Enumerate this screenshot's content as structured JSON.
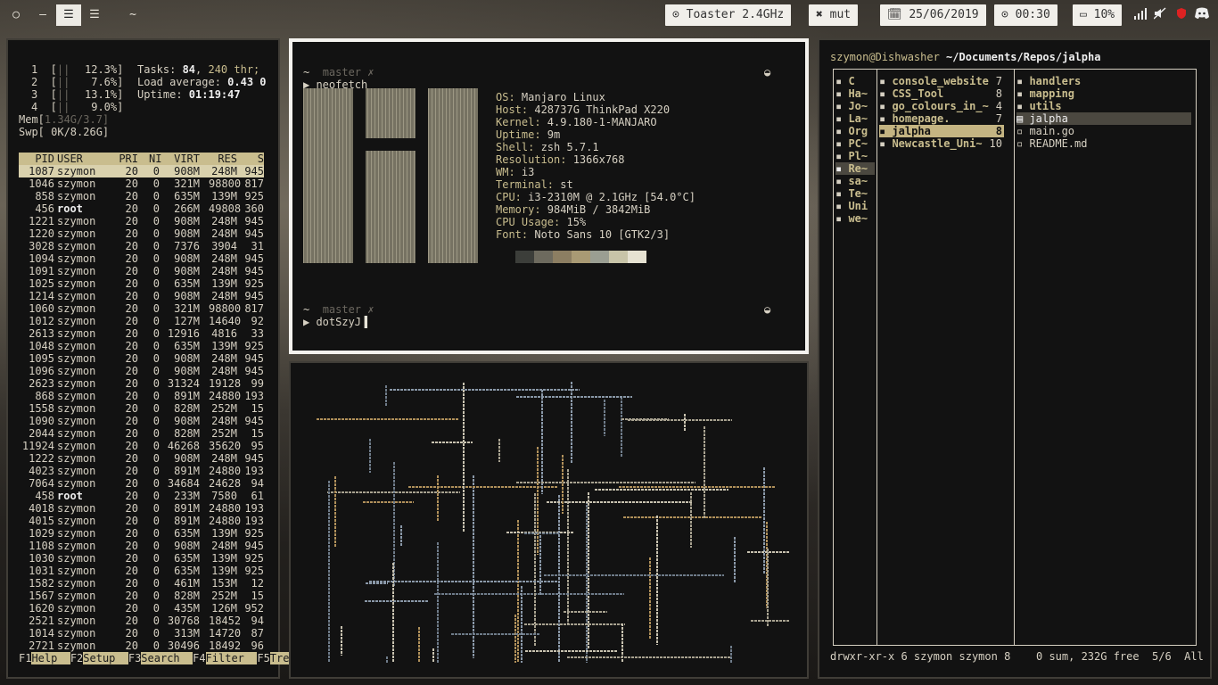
{
  "topbar": {
    "workspaces": [
      "○",
      "—",
      "☰",
      "☰",
      "~"
    ],
    "active_workspace": 2,
    "status": {
      "cpu": "⊙ Toaster 2.4GHz",
      "volume": "✖ mut",
      "date": "🗓 25/06/2019",
      "time": "⊙ 00:30",
      "battery": "▭ 10%"
    }
  },
  "htop": {
    "cpus": [
      {
        "id": "1",
        "pct": "12.3%]"
      },
      {
        "id": "2",
        "pct": "7.6%]"
      },
      {
        "id": "3",
        "pct": "13.1%]"
      },
      {
        "id": "4",
        "pct": "9.0%]"
      }
    ],
    "mem": "1.34G/3.7]",
    "swp": "0K/8.26G]",
    "tasks_label": "Tasks: ",
    "tasks": "84",
    "threads": "240 thr;",
    "load_label": "Load average: ",
    "load": "0.43 0",
    "uptime_label": "Uptime: ",
    "uptime": "01:19:47",
    "columns": [
      "PID",
      "USER",
      "PRI",
      "NI",
      "VIRT",
      "RES",
      "S"
    ],
    "rows": [
      [
        "1087",
        "szymon",
        "20",
        "0",
        "908M",
        "248M",
        "945"
      ],
      [
        "1046",
        "szymon",
        "20",
        "0",
        "321M",
        "98800",
        "817"
      ],
      [
        "858",
        "szymon",
        "20",
        "0",
        "635M",
        "139M",
        "925"
      ],
      [
        "456",
        "root",
        "20",
        "0",
        "266M",
        "49808",
        "360"
      ],
      [
        "1221",
        "szymon",
        "20",
        "0",
        "908M",
        "248M",
        "945"
      ],
      [
        "1220",
        "szymon",
        "20",
        "0",
        "908M",
        "248M",
        "945"
      ],
      [
        "3028",
        "szymon",
        "20",
        "0",
        "7376",
        "3904",
        "31"
      ],
      [
        "1094",
        "szymon",
        "20",
        "0",
        "908M",
        "248M",
        "945"
      ],
      [
        "1091",
        "szymon",
        "20",
        "0",
        "908M",
        "248M",
        "945"
      ],
      [
        "1025",
        "szymon",
        "20",
        "0",
        "635M",
        "139M",
        "925"
      ],
      [
        "1214",
        "szymon",
        "20",
        "0",
        "908M",
        "248M",
        "945"
      ],
      [
        "1060",
        "szymon",
        "20",
        "0",
        "321M",
        "98800",
        "817"
      ],
      [
        "1012",
        "szymon",
        "20",
        "0",
        "127M",
        "14640",
        "92"
      ],
      [
        "2613",
        "szymon",
        "20",
        "0",
        "12916",
        "4816",
        "33"
      ],
      [
        "1048",
        "szymon",
        "20",
        "0",
        "635M",
        "139M",
        "925"
      ],
      [
        "1095",
        "szymon",
        "20",
        "0",
        "908M",
        "248M",
        "945"
      ],
      [
        "1096",
        "szymon",
        "20",
        "0",
        "908M",
        "248M",
        "945"
      ],
      [
        "2623",
        "szymon",
        "20",
        "0",
        "31324",
        "19128",
        "99"
      ],
      [
        "868",
        "szymon",
        "20",
        "0",
        "891M",
        "24880",
        "193"
      ],
      [
        "1558",
        "szymon",
        "20",
        "0",
        "828M",
        "252M",
        "15"
      ],
      [
        "1090",
        "szymon",
        "20",
        "0",
        "908M",
        "248M",
        "945"
      ],
      [
        "2044",
        "szymon",
        "20",
        "0",
        "828M",
        "252M",
        "15"
      ],
      [
        "11924",
        "szymon",
        "20",
        "0",
        "46268",
        "35620",
        "95"
      ],
      [
        "1222",
        "szymon",
        "20",
        "0",
        "908M",
        "248M",
        "945"
      ],
      [
        "4023",
        "szymon",
        "20",
        "0",
        "891M",
        "24880",
        "193"
      ],
      [
        "7064",
        "szymon",
        "20",
        "0",
        "34684",
        "24628",
        "94"
      ],
      [
        "458",
        "root",
        "20",
        "0",
        "233M",
        "7580",
        "61"
      ],
      [
        "4018",
        "szymon",
        "20",
        "0",
        "891M",
        "24880",
        "193"
      ],
      [
        "4015",
        "szymon",
        "20",
        "0",
        "891M",
        "24880",
        "193"
      ],
      [
        "1029",
        "szymon",
        "20",
        "0",
        "635M",
        "139M",
        "925"
      ],
      [
        "1108",
        "szymon",
        "20",
        "0",
        "908M",
        "248M",
        "945"
      ],
      [
        "1030",
        "szymon",
        "20",
        "0",
        "635M",
        "139M",
        "925"
      ],
      [
        "1031",
        "szymon",
        "20",
        "0",
        "635M",
        "139M",
        "925"
      ],
      [
        "1582",
        "szymon",
        "20",
        "0",
        "461M",
        "153M",
        "12"
      ],
      [
        "1567",
        "szymon",
        "20",
        "0",
        "828M",
        "252M",
        "15"
      ],
      [
        "1620",
        "szymon",
        "20",
        "0",
        "435M",
        "126M",
        "952"
      ],
      [
        "2521",
        "szymon",
        "20",
        "0",
        "30768",
        "18452",
        "94"
      ],
      [
        "1014",
        "szymon",
        "20",
        "0",
        "313M",
        "14720",
        "87"
      ],
      [
        "2721",
        "szymon",
        "20",
        "0",
        "30496",
        "18492",
        "96"
      ]
    ],
    "fkeys": [
      [
        "F1",
        "Help"
      ],
      [
        "F2",
        "Setup"
      ],
      [
        "F3",
        "Search"
      ],
      [
        "F4",
        "Filter"
      ],
      [
        "F5",
        "Tree"
      ]
    ]
  },
  "terminal": {
    "prompt1_dir": "~",
    "prompt1_branch": "master ✗",
    "cmd1": "▶ neofetch",
    "info": [
      [
        "OS: ",
        "Manjaro Linux"
      ],
      [
        "Host: ",
        "428737G ThinkPad X220"
      ],
      [
        "Kernel: ",
        "4.9.180-1-MANJARO"
      ],
      [
        "Uptime: ",
        "9m"
      ],
      [
        "Shell: ",
        "zsh 5.7.1"
      ],
      [
        "Resolution: ",
        "1366x768"
      ],
      [
        "WM: ",
        "i3"
      ],
      [
        "Terminal: ",
        "st"
      ],
      [
        "CPU: ",
        "i3-2310M @ 2.1GHz [54.0°C]"
      ],
      [
        "Memory: ",
        "984MiB / 3842MiB"
      ],
      [
        "CPU Usage: ",
        "15%"
      ],
      [
        "Font: ",
        "Noto Sans 10 [GTK2/3]"
      ]
    ],
    "palette": [
      "#3c3e3a",
      "#6d6a5e",
      "#8c7e62",
      "#a99a74",
      "#9a9e92",
      "#c8c4a8",
      "#e6e2d2"
    ],
    "prompt2_dir": "~",
    "prompt2_branch": "master ✗",
    "cmd2": "▶ dotSzyJ"
  },
  "ranger": {
    "path_user": "szymon@Dishwasher",
    "path_dir": " ~/Documents/Repos/",
    "path_cur": "jalpha",
    "col1": [
      "C",
      "Ha~",
      "Jo~",
      "La~",
      "Org",
      "PC~",
      "Pl~",
      "Re~",
      "sa~",
      "Te~",
      "Uni",
      "we~"
    ],
    "col1_selected": 7,
    "col2": [
      [
        "console_website",
        "7"
      ],
      [
        "CSS_Tool",
        "8"
      ],
      [
        "go_colours_in_~",
        "4"
      ],
      [
        "homepage.",
        "7"
      ],
      [
        "jalpha",
        "8"
      ],
      [
        "Newcastle_Uni~",
        "10"
      ]
    ],
    "col2_selected": 4,
    "col3": [
      "handlers",
      "mapping",
      "utils",
      "jalpha",
      "main.go",
      "README.md"
    ],
    "col3_selected": 3,
    "status_left": "drwxr-xr-x 6 szymon szymon 8",
    "status_right": "0 sum, 232G free  5/6  All"
  }
}
